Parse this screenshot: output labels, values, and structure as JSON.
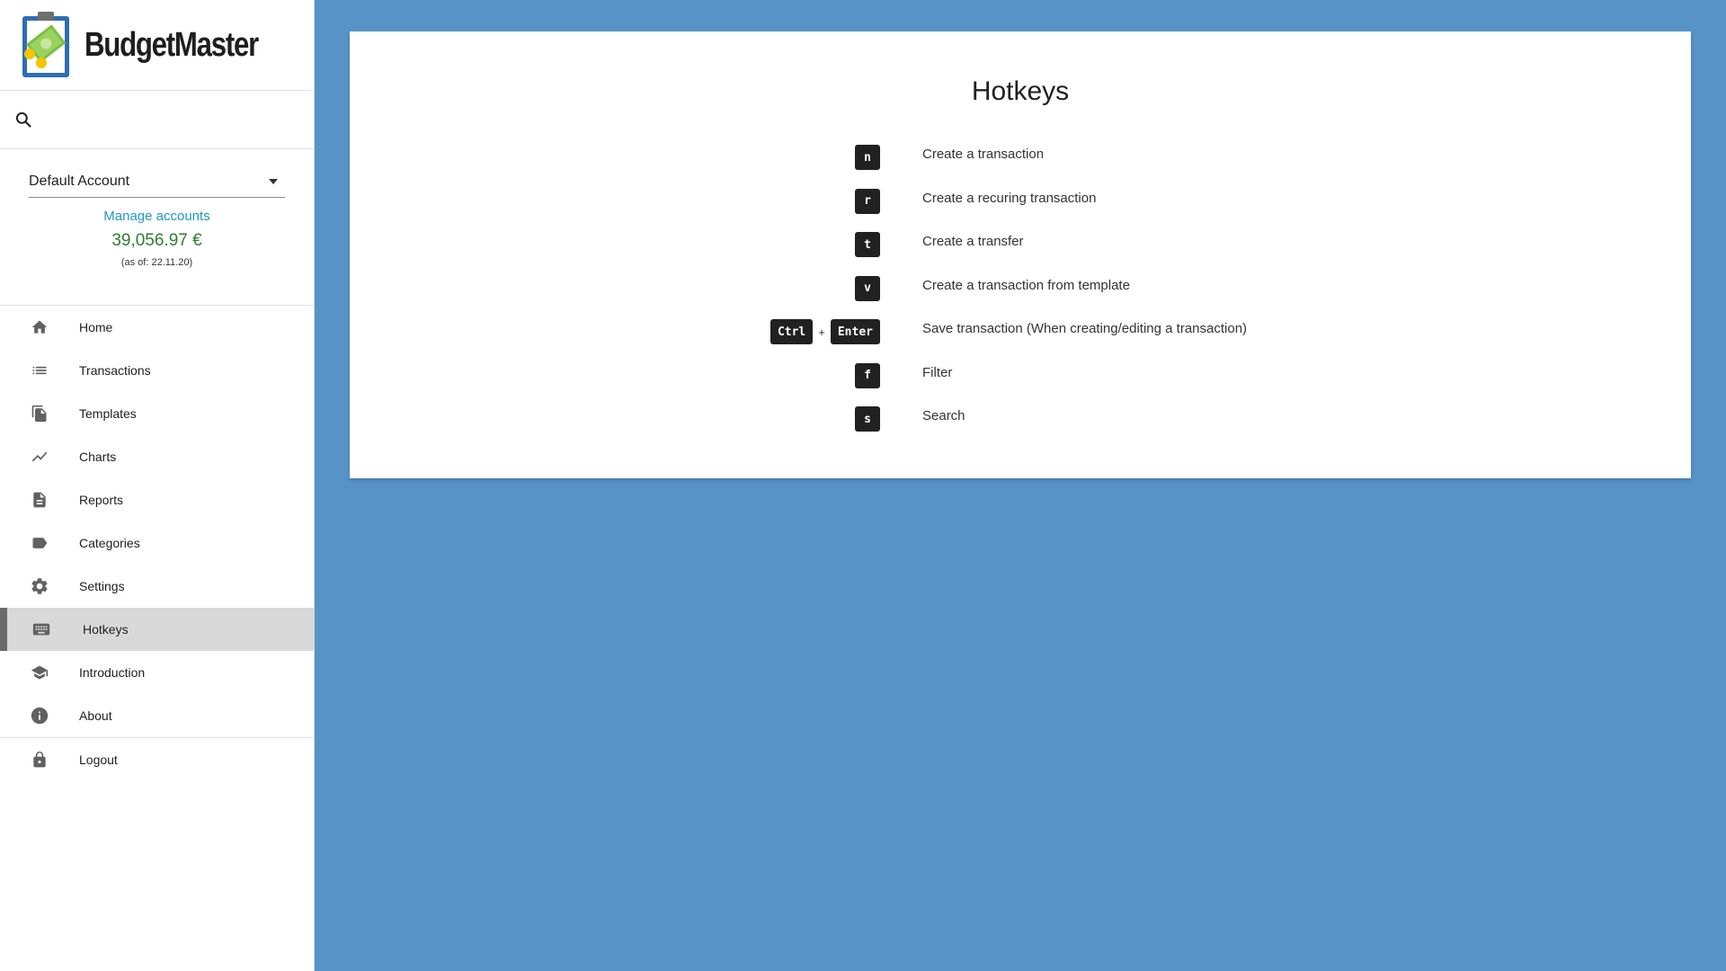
{
  "app": {
    "name": "BudgetMaster"
  },
  "search": {
    "placeholder": ""
  },
  "account": {
    "selected": "Default Account",
    "manage_label": "Manage accounts",
    "balance": "39,056.97 €",
    "as_of": "(as of: 22.11.20)"
  },
  "nav": {
    "items": [
      {
        "label": "Home",
        "icon": "home-icon"
      },
      {
        "label": "Transactions",
        "icon": "list-icon"
      },
      {
        "label": "Templates",
        "icon": "copy-icon"
      },
      {
        "label": "Charts",
        "icon": "chart-line-icon"
      },
      {
        "label": "Reports",
        "icon": "document-icon"
      },
      {
        "label": "Categories",
        "icon": "label-icon"
      },
      {
        "label": "Settings",
        "icon": "gear-icon"
      },
      {
        "label": "Hotkeys",
        "icon": "keyboard-icon",
        "active": true
      },
      {
        "label": "Introduction",
        "icon": "school-icon"
      },
      {
        "label": "About",
        "icon": "info-icon"
      },
      {
        "label": "Logout",
        "icon": "lock-icon"
      }
    ]
  },
  "hotkeys": {
    "title": "Hotkeys",
    "rows": [
      {
        "keys": [
          "n"
        ],
        "description": "Create a transaction"
      },
      {
        "keys": [
          "r"
        ],
        "description": "Create a recuring transaction"
      },
      {
        "keys": [
          "t"
        ],
        "description": "Create a transfer"
      },
      {
        "keys": [
          "v"
        ],
        "description": "Create a transaction from template"
      },
      {
        "keys": [
          "Ctrl",
          "Enter"
        ],
        "separator": "+",
        "description": "Save transaction (When creating/editing a transaction)"
      },
      {
        "keys": [
          "f"
        ],
        "description": "Filter"
      },
      {
        "keys": [
          "s"
        ],
        "description": "Search"
      }
    ]
  },
  "colors": {
    "background": "#5893c7",
    "balance": "#2e7d32",
    "link": "#2196c8",
    "key": "#212121",
    "active_nav": "#d9d9d9"
  }
}
